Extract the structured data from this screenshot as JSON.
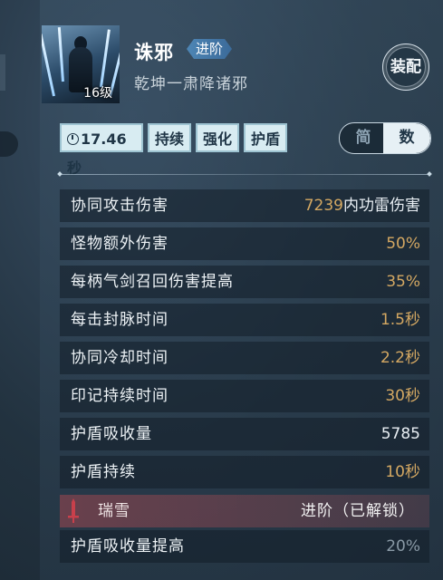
{
  "skill": {
    "name": "诛邪",
    "advance_tag": "进阶",
    "subtitle": "乾坤一肃降诸邪",
    "level": "16级",
    "equip_label": "装配"
  },
  "tags": {
    "cooldown": "17.46秒",
    "t2": "持续",
    "t3": "强化",
    "t4": "护盾"
  },
  "toggle": {
    "simple": "简",
    "detail": "数",
    "selected": "数"
  },
  "stats": [
    {
      "label": "协同攻击伤害",
      "value": "7239",
      "suffix": "内功雷伤害"
    },
    {
      "label": "怪物额外伤害",
      "value": "50%"
    },
    {
      "label": "每柄气剑召回伤害提高",
      "value": "35%"
    },
    {
      "label": "每击封脉时间",
      "value": "1.5秒"
    },
    {
      "label": "协同冷却时间",
      "value": "2.2秒"
    },
    {
      "label": "印记持续时间",
      "value": "30秒"
    },
    {
      "label": "护盾吸收量",
      "value": "5785"
    },
    {
      "label": "护盾持续",
      "value": "10秒"
    }
  ],
  "special": {
    "label": "瑞雪",
    "value": "进阶（已解锁）"
  },
  "extra_stat": {
    "label": "护盾吸收量提高",
    "value": "20%"
  },
  "colors": {
    "gold": "#d4a862",
    "tag_bg": "#d8ecf2",
    "special_row": "#96464f"
  }
}
